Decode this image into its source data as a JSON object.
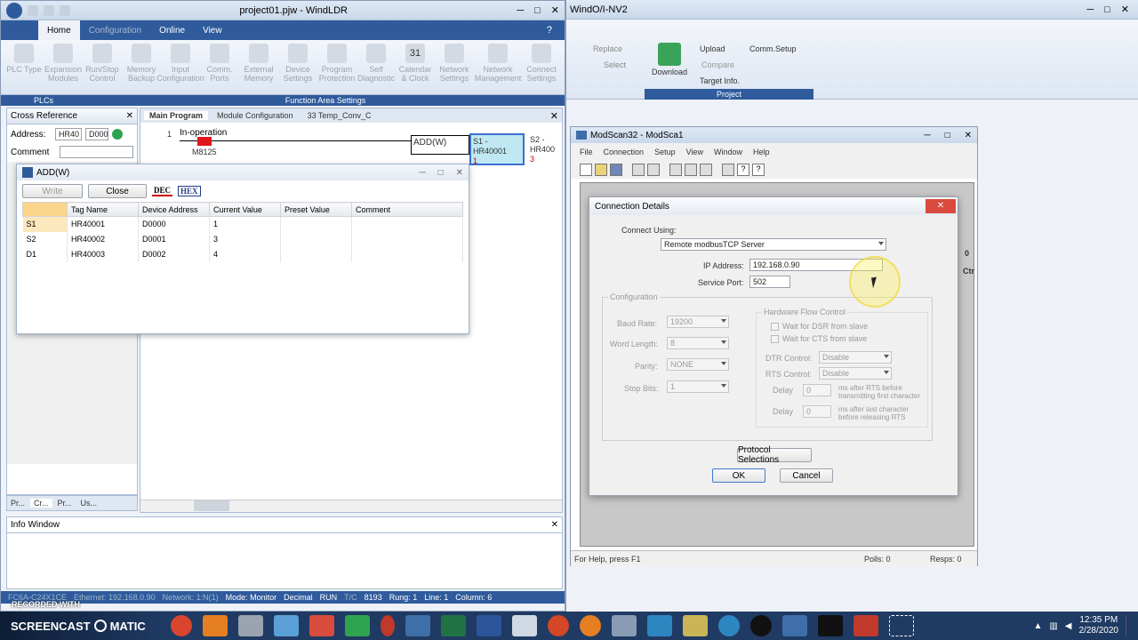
{
  "windldr": {
    "title": "project01.pjw - WindLDR",
    "tabs": [
      "Home",
      "Configuration",
      "Online",
      "View"
    ],
    "ribbon_buttons": [
      "PLC Type",
      "Expansion Modules",
      "Run/Stop Control",
      "Memory Backup",
      "Input Configuration",
      "Comm. Ports",
      "External Memory",
      "Device Settings",
      "Program Protection",
      "Self Diagnostic",
      "Calendar & Clock",
      "Network Settings",
      "Network Management",
      "Connect Settings"
    ],
    "calendar_day": "31",
    "group_plcs": "PLCs",
    "group_function": "Function Area Settings",
    "cross_ref": {
      "title": "Cross Reference",
      "address_label": "Address:",
      "address_value": "HR40",
      "address_value2": "D000",
      "comment_label": "Comment"
    },
    "doc_tabs": [
      "Main Program",
      "Module Configuration",
      "33 Temp_Conv_C"
    ],
    "ladder": {
      "rung": "1",
      "comment": "In-operation",
      "contact": "M8125",
      "instr": "ADD(W)",
      "s1": "S1 -",
      "s1_addr": "HR40001",
      "s1_val": "1",
      "s2": "S2 -",
      "s2_addr": "HR400",
      "s2_val": "3"
    },
    "side_tabs": [
      "Pr...",
      "Cr...",
      "Pr...",
      "Us..."
    ],
    "info_window": "Info Window",
    "status": {
      "plc": "FC6A-C24X1CE",
      "eth": "Ethernet: 192.168.0.90",
      "network": "Network: 1:N(1)",
      "mode": "Mode: Monitor",
      "decimal": "Decimal",
      "run": "RUN",
      "tc": "T/C",
      "size": "8193",
      "rung": "Rung: 1",
      "line": "Line: 1",
      "column": "Column: 6"
    },
    "recorded_with": "RECORDED WITH",
    "screencast": "SCREENCAST",
    "matic": "MATIC"
  },
  "windldr2": {
    "title": "WindO/I-NV2",
    "replace": "Replace",
    "select": "Select",
    "download": "Download",
    "upload": "Upload",
    "compare": "Compare",
    "comm_setup": "Comm.Setup",
    "target_info": "Target Info.",
    "project": "Project"
  },
  "addw": {
    "title": "ADD(W)",
    "write_label": "Write",
    "close_label": "Close",
    "dec": "DEC",
    "hex": "HEX",
    "columns": [
      "",
      "Tag Name",
      "Device Address",
      "Current Value",
      "Preset Value",
      "Comment"
    ],
    "rows": [
      [
        "S1",
        "HR40001",
        "D0000",
        "1",
        "",
        ""
      ],
      [
        "S2",
        "HR40002",
        "D0001",
        "3",
        "",
        ""
      ],
      [
        "D1",
        "HR40003",
        "D0002",
        "4",
        "",
        ""
      ]
    ]
  },
  "modscan": {
    "title": "ModScan32 - ModSca1",
    "menu": [
      "File",
      "Connection",
      "Setup",
      "View",
      "Window",
      "Help"
    ],
    "status_help": "For Help, press F1",
    "polls": "Polls: 0",
    "resps": "Resps: 0",
    "side_chars": [
      "0",
      "Ctr"
    ]
  },
  "conn": {
    "title": "Connection Details",
    "connect_using_label": "Connect Using:",
    "connect_using": "Remote modbusTCP Server",
    "ip_label": "IP Address:",
    "ip": "192.168.0.90",
    "port_label": "Service Port:",
    "port": "502",
    "config_label": "Configuration",
    "baud_label": "Baud Rate:",
    "baud": "19200",
    "word_label": "Word Length:",
    "word": "8",
    "parity_label": "Parity:",
    "parity": "NONE",
    "stop_label": "Stop Bits:",
    "stop": "1",
    "hfc_label": "Hardware Flow Control",
    "dsr": "Wait for DSR from slave",
    "cts": "Wait for CTS from slave",
    "dtr_label": "DTR Control:",
    "dtr": "Disable",
    "rts_label": "RTS Control:",
    "rts": "Disable",
    "delay_label": "Delay",
    "delay1": "0",
    "delay1_note": "ms after RTS before transmitting first character",
    "delay2": "0",
    "delay2_note": "ms after last character before releasing RTS",
    "protocol_btn": "Protocol Selections",
    "ok": "OK",
    "cancel": "Cancel"
  },
  "taskbar": {
    "time": "12:35 PM",
    "date": "2/28/2020"
  },
  "colors": {
    "ribbon_blue": "#2f5b9c",
    "highlight": "#bfe8f2",
    "contact_red": "#e0161b",
    "taskbar": "#1f3a63"
  }
}
